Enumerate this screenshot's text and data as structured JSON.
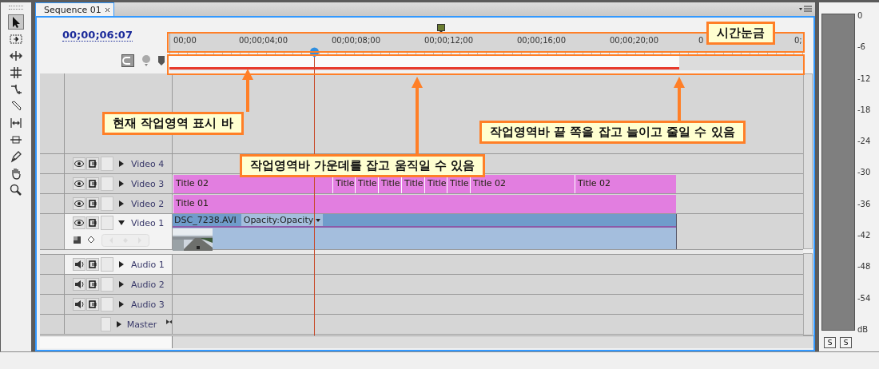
{
  "tabs": [
    {
      "label": "Sequence 01",
      "selected": true
    }
  ],
  "timecode": "00;00;06:07",
  "ruler_labels": [
    "00;00",
    "00;00;04;00",
    "00;00;08;00",
    "00;00;12;00",
    "00;00;16;00",
    "00;00;20;00",
    "0",
    "0;"
  ],
  "tracks": [
    {
      "name": "Video 4",
      "kind": "video",
      "expanded": false,
      "targeted": false
    },
    {
      "name": "Video 3",
      "kind": "video",
      "expanded": false,
      "targeted": false,
      "clips": [
        {
          "label": "Title 02"
        },
        {
          "label": "Title"
        },
        {
          "label": "Title"
        },
        {
          "label": "Title"
        },
        {
          "label": "Title"
        },
        {
          "label": "Title"
        },
        {
          "label": "Title"
        },
        {
          "label": "Title 02"
        },
        {
          "label": "Title 02"
        }
      ]
    },
    {
      "name": "Video 2",
      "kind": "video",
      "expanded": false,
      "targeted": false,
      "clips": [
        {
          "label": "Title 01"
        }
      ]
    },
    {
      "name": "Video 1",
      "kind": "video",
      "expanded": true,
      "targeted": true,
      "clips": [
        {
          "label": "DSC_7238.AVI",
          "effect": "Opacity:Opacity"
        }
      ]
    },
    {
      "name": "Audio 1",
      "kind": "audio",
      "expanded": false,
      "targeted": true
    },
    {
      "name": "Audio 2",
      "kind": "audio",
      "expanded": false,
      "targeted": false
    },
    {
      "name": "Audio 3",
      "kind": "audio",
      "expanded": false,
      "targeted": false
    },
    {
      "name": "Master",
      "kind": "master",
      "expanded": false,
      "targeted": false
    }
  ],
  "annotations": [
    {
      "text": "시간눈금"
    },
    {
      "text": "현재 작업영역 표시 바"
    },
    {
      "text": "작업영역바 가운데를 잡고 움직일 수 있음"
    },
    {
      "text": "작업영역바 끝 쪽을 잡고 늘이고 줄일 수 있음"
    }
  ],
  "meter": {
    "scale": [
      "0",
      "-6",
      "-12",
      "-18",
      "-24",
      "-30",
      "-36",
      "-42",
      "-48",
      "-54",
      "dB"
    ],
    "solo_buttons": [
      "S",
      "S"
    ]
  }
}
